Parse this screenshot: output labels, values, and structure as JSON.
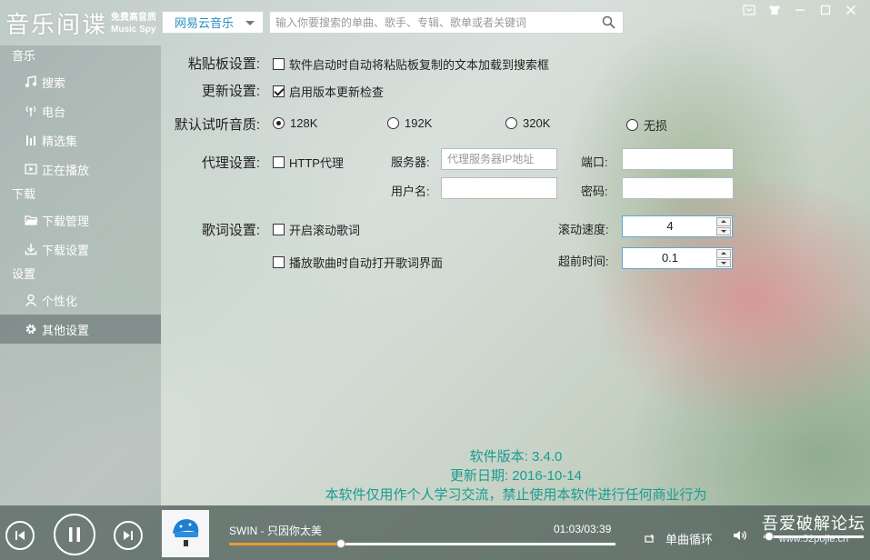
{
  "app": {
    "logo_main": "音乐间谍",
    "logo_sub1": "免费高音质",
    "logo_sub2": "Music  Spy"
  },
  "header": {
    "source_selected": "网易云音乐",
    "search_placeholder": "输入你要搜索的单曲、歌手、专辑、歌单或者关键词"
  },
  "sidebar": {
    "sections": [
      {
        "title": "音乐",
        "items": [
          {
            "label": "搜索",
            "icon": "music-note-icon"
          },
          {
            "label": "电台",
            "icon": "radio-icon"
          },
          {
            "label": "精选集",
            "icon": "bars-icon"
          },
          {
            "label": "正在播放",
            "icon": "play-screen-icon"
          }
        ]
      },
      {
        "title": "下载",
        "items": [
          {
            "label": "下载管理",
            "icon": "folder-icon"
          },
          {
            "label": "下载设置",
            "icon": "download-icon"
          }
        ]
      },
      {
        "title": "设置",
        "items": [
          {
            "label": "个性化",
            "icon": "user-icon"
          },
          {
            "label": "其他设置",
            "icon": "gear-icon",
            "active": true
          }
        ]
      }
    ]
  },
  "settings": {
    "clipboard": {
      "label": "粘贴板设置:",
      "option": "软件启动时自动将粘贴板复制的文本加载到搜索框",
      "checked": false
    },
    "update": {
      "label": "更新设置:",
      "option": "启用版本更新检查",
      "checked": true
    },
    "quality": {
      "label": "默认试听音质:",
      "options": [
        "128K",
        "192K",
        "320K",
        "无损"
      ],
      "selected": "128K"
    },
    "proxy": {
      "label": "代理设置:",
      "option": "HTTP代理",
      "checked": false,
      "server_label": "服务器:",
      "server_placeholder": "代理服务器IP地址",
      "port_label": "端口:",
      "user_label": "用户名:",
      "password_label": "密码:"
    },
    "lyrics": {
      "label": "歌词设置:",
      "scroll_option": "开启滚动歌词",
      "scroll_checked": false,
      "auto_open_option": "播放歌曲时自动打开歌词界面",
      "auto_open_checked": false,
      "speed_label": "滚动速度:",
      "speed_value": "4",
      "advance_label": "超前时间:",
      "advance_value": "0.1"
    }
  },
  "about": {
    "version": "软件版本: 3.4.0",
    "date": "更新日期: 2016-10-14",
    "notice": "本软件仅用作个人学习交流，禁止使用本软件进行任何商业行为"
  },
  "player": {
    "song": "SWIN - 只因你太美",
    "time": "01:03/03:39",
    "progress": 0.29,
    "loop_mode": "单曲循环",
    "volume": 0.05
  },
  "watermark": {
    "line1": "吾爱破解论坛",
    "line2": "www.52pojie.cn"
  }
}
